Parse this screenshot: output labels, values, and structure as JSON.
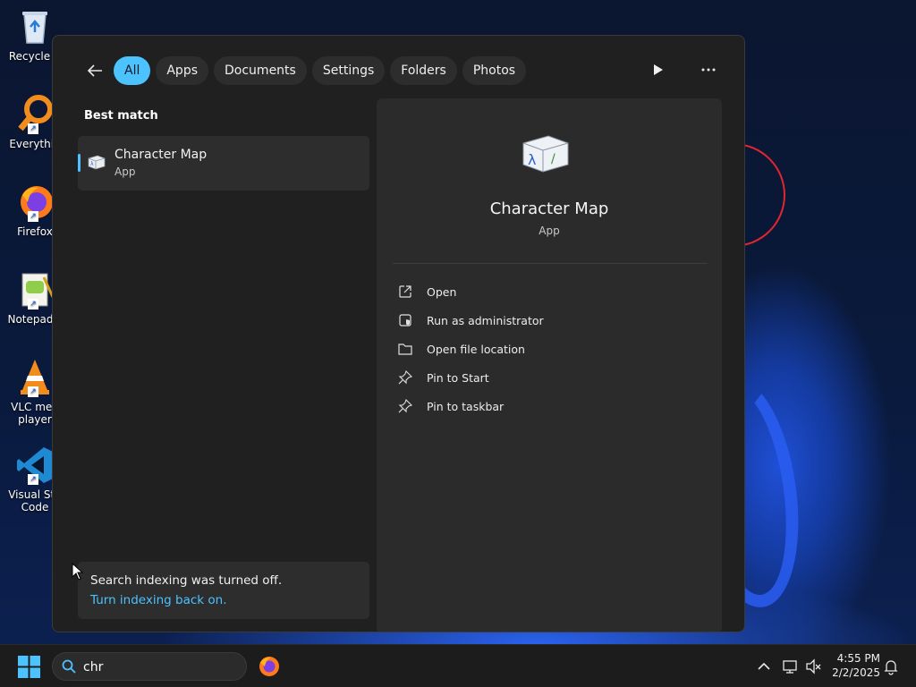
{
  "desktop": {
    "icons": [
      {
        "label": "Recycle B",
        "icon": "recycle-bin-icon"
      },
      {
        "label": "Everythin",
        "icon": "everything-search-icon"
      },
      {
        "label": "Firefox",
        "icon": "firefox-icon"
      },
      {
        "label": "Notepad+",
        "icon": "notepad-plus-plus-icon"
      },
      {
        "label": "VLC med player",
        "icon": "vlc-icon"
      },
      {
        "label": "Visual Stu Code",
        "icon": "vscode-icon"
      }
    ]
  },
  "search_flyout": {
    "filters": [
      "All",
      "Apps",
      "Documents",
      "Settings",
      "Folders",
      "Photos"
    ],
    "active_filter": "All",
    "best_match_label": "Best match",
    "best_match": {
      "name": "Character Map",
      "type": "App"
    },
    "indexing": {
      "message": "Search indexing was turned off.",
      "link": "Turn indexing back on."
    },
    "preview": {
      "name": "Character Map",
      "type": "App",
      "actions": [
        {
          "label": "Open",
          "icon": "open-external-icon"
        },
        {
          "label": "Run as administrator",
          "icon": "shield-admin-icon"
        },
        {
          "label": "Open file location",
          "icon": "folder-icon"
        },
        {
          "label": "Pin to Start",
          "icon": "pin-icon"
        },
        {
          "label": "Pin to taskbar",
          "icon": "pin-icon"
        }
      ]
    }
  },
  "taskbar": {
    "search_value": "chr",
    "clock": {
      "time": "4:55 PM",
      "date": "2/2/2025"
    }
  },
  "colors": {
    "accent": "#4cc2ff",
    "flyout_bg": "#202020",
    "pane_bg": "#2b2b2b"
  }
}
